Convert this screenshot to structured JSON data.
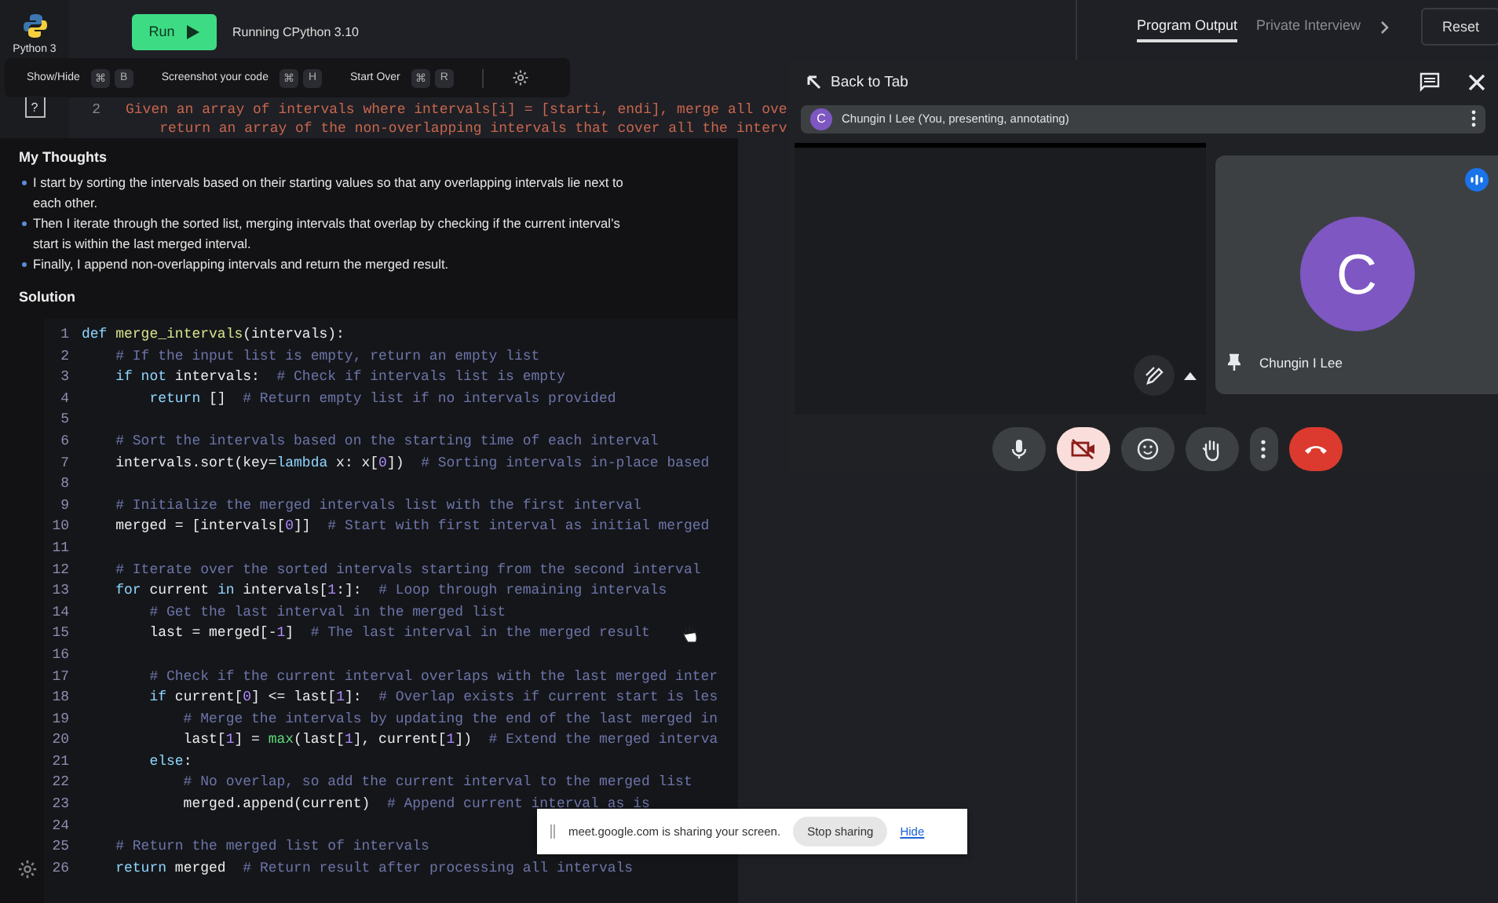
{
  "sidebar": {
    "language": "Python 3",
    "help_icon": "?"
  },
  "toolbar": {
    "run_button": "Run",
    "runtime": "Running CPython 3.10"
  },
  "editor": {
    "lines": [
      {
        "number": "2",
        "text_lines": [
          "Given an array of intervals where intervals[i] = [starti, endi], merge all ove",
          "    return an array of the non-overlapping intervals that cover all the interv"
        ]
      }
    ]
  },
  "output_panel": {
    "tabs": [
      {
        "label": "Program Output",
        "selected": true
      },
      {
        "label": "Private Interview",
        "selected": false
      }
    ],
    "reset_button": "Reset"
  },
  "shortcuts": [
    {
      "label": "Show/Hide",
      "keys": [
        "⌘",
        "B"
      ]
    },
    {
      "label": "Screenshot your code",
      "keys": [
        "⌘",
        "H"
      ]
    },
    {
      "label": "Start Over",
      "keys": [
        "⌘",
        "R"
      ]
    }
  ],
  "notes": {
    "title": "My Thoughts",
    "bullets": [
      "I start by sorting the intervals based on their starting values so that any overlapping intervals lie next to each other.",
      "Then I iterate through the sorted list, merging intervals that overlap by checking if the current interval’s start is within the last merged interval.",
      "Finally, I append non-overlapping intervals and return the merged result."
    ],
    "solution_title": "Solution",
    "code": [
      {
        "number": "1",
        "tokens": [
          {
            "kind": "keyword",
            "text": "def "
          },
          {
            "kind": "function",
            "text": "merge_intervals"
          },
          {
            "kind": "plain",
            "text": "(intervals):"
          }
        ]
      },
      {
        "number": "2",
        "tokens": [
          {
            "kind": "comment",
            "text": "    # If the input list is empty, return an empty list"
          }
        ]
      },
      {
        "number": "3",
        "tokens": [
          {
            "kind": "keyword",
            "text": "    if not "
          },
          {
            "kind": "plain",
            "text": "intervals:  "
          },
          {
            "kind": "comment",
            "text": "# Check if intervals list is empty"
          }
        ]
      },
      {
        "number": "4",
        "tokens": [
          {
            "kind": "keyword",
            "text": "        return "
          },
          {
            "kind": "plain",
            "text": "[]  "
          },
          {
            "kind": "comment",
            "text": "# Return empty list if no intervals provided"
          }
        ]
      },
      {
        "number": "5"
      },
      {
        "number": "6",
        "tokens": [
          {
            "kind": "comment",
            "text": "    # Sort the intervals based on the starting time of each interval"
          }
        ]
      },
      {
        "number": "7",
        "tokens": [
          {
            "kind": "plain",
            "text": "    intervals.sort(key="
          },
          {
            "kind": "keyword",
            "text": "lambda"
          },
          {
            "kind": "plain",
            "text": " x: x["
          },
          {
            "kind": "number",
            "text": "0"
          },
          {
            "kind": "plain",
            "text": "])  "
          },
          {
            "kind": "comment",
            "text": "# Sorting intervals in-place based"
          }
        ]
      },
      {
        "number": "8"
      },
      {
        "number": "9",
        "tokens": [
          {
            "kind": "comment",
            "text": "    # Initialize the merged intervals list with the first interval"
          }
        ]
      },
      {
        "number": "10",
        "tokens": [
          {
            "kind": "plain",
            "text": "    merged = [intervals["
          },
          {
            "kind": "number",
            "text": "0"
          },
          {
            "kind": "plain",
            "text": "]]  "
          },
          {
            "kind": "comment",
            "text": "# Start with first interval as initial merged"
          }
        ]
      },
      {
        "number": "11"
      },
      {
        "number": "12",
        "tokens": [
          {
            "kind": "comment",
            "text": "    # Iterate over the sorted intervals starting from the second interval"
          }
        ]
      },
      {
        "number": "13",
        "tokens": [
          {
            "kind": "keyword",
            "text": "    for "
          },
          {
            "kind": "plain",
            "text": "current "
          },
          {
            "kind": "keyword",
            "text": "in "
          },
          {
            "kind": "plain",
            "text": "intervals["
          },
          {
            "kind": "number",
            "text": "1"
          },
          {
            "kind": "plain",
            "text": ":]:  "
          },
          {
            "kind": "comment",
            "text": "# Loop through remaining intervals"
          }
        ]
      },
      {
        "number": "14",
        "tokens": [
          {
            "kind": "comment",
            "text": "        # Get the last interval in the merged list"
          }
        ]
      },
      {
        "number": "15",
        "tokens": [
          {
            "kind": "plain",
            "text": "        last = merged[-"
          },
          {
            "kind": "number",
            "text": "1"
          },
          {
            "kind": "plain",
            "text": "]  "
          },
          {
            "kind": "comment",
            "text": "# The last interval in the merged result"
          }
        ]
      },
      {
        "number": "16"
      },
      {
        "number": "17",
        "tokens": [
          {
            "kind": "comment",
            "text": "        # Check if the current interval overlaps with the last merged inter"
          }
        ]
      },
      {
        "number": "18",
        "tokens": [
          {
            "kind": "keyword",
            "text": "        if "
          },
          {
            "kind": "plain",
            "text": "current["
          },
          {
            "kind": "number",
            "text": "0"
          },
          {
            "kind": "plain",
            "text": "] <= last["
          },
          {
            "kind": "number",
            "text": "1"
          },
          {
            "kind": "plain",
            "text": "]:  "
          },
          {
            "kind": "comment",
            "text": "# Overlap exists if current start is les"
          }
        ]
      },
      {
        "number": "19",
        "tokens": [
          {
            "kind": "comment",
            "text": "            # Merge the intervals by updating the end of the last merged in"
          }
        ]
      },
      {
        "number": "20",
        "tokens": [
          {
            "kind": "plain",
            "text": "            last["
          },
          {
            "kind": "number",
            "text": "1"
          },
          {
            "kind": "plain",
            "text": "] = "
          },
          {
            "kind": "builtin",
            "text": "max"
          },
          {
            "kind": "plain",
            "text": "(last["
          },
          {
            "kind": "number",
            "text": "1"
          },
          {
            "kind": "plain",
            "text": "], current["
          },
          {
            "kind": "number",
            "text": "1"
          },
          {
            "kind": "plain",
            "text": "])  "
          },
          {
            "kind": "comment",
            "text": "# Extend the merged interva"
          }
        ]
      },
      {
        "number": "21",
        "tokens": [
          {
            "kind": "keyword",
            "text": "        else"
          },
          {
            "kind": "plain",
            "text": ":"
          }
        ]
      },
      {
        "number": "22",
        "tokens": [
          {
            "kind": "comment",
            "text": "            # No overlap, so add the current interval to the merged list"
          }
        ]
      },
      {
        "number": "23",
        "tokens": [
          {
            "kind": "plain",
            "text": "            merged.append(current)  "
          },
          {
            "kind": "comment",
            "text": "# Append current interval as is"
          }
        ]
      },
      {
        "number": "24"
      },
      {
        "number": "25",
        "tokens": [
          {
            "kind": "comment",
            "text": "    # Return the merged list of intervals"
          }
        ]
      },
      {
        "number": "26",
        "tokens": [
          {
            "kind": "keyword",
            "text": "    return "
          },
          {
            "kind": "plain",
            "text": "merged  "
          },
          {
            "kind": "comment",
            "text": "# Return result after processing all intervals"
          }
        ]
      }
    ]
  },
  "meet": {
    "back_label": "Back to Tab",
    "presenter": {
      "initial": "C",
      "label": "Chungin I Lee (You, presenting, annotating)"
    },
    "participant": {
      "initial": "C",
      "name": "Chungin I Lee",
      "speaking": true
    },
    "controls": [
      {
        "kind": "mic",
        "on": true
      },
      {
        "kind": "camera",
        "on": false
      },
      {
        "kind": "emoji"
      },
      {
        "kind": "hand"
      },
      {
        "kind": "more"
      },
      {
        "kind": "hangup"
      }
    ]
  },
  "share_banner": {
    "message": "meet.google.com is sharing your screen.",
    "stop_button": "Stop sharing",
    "hide_link": "Hide"
  }
}
